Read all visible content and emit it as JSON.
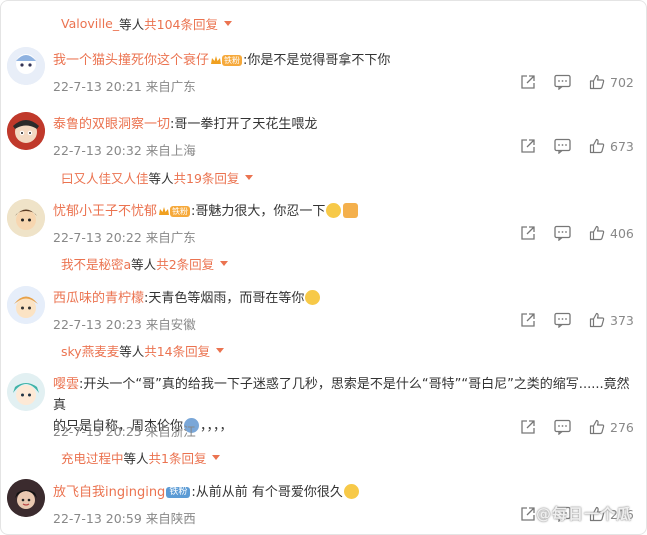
{
  "top_reply": {
    "user": "Valoville_",
    "middle": " 等人 ",
    "count": "共104条回复"
  },
  "comments": [
    {
      "user": "我一个猫头撞死你这个衰仔",
      "badge": "铁粉",
      "text": ":你是不是觉得哥拿不下你",
      "meta": "22-7-13 20:21 来自广东",
      "likes": "702"
    },
    {
      "user": "泰鲁的双眼洞察一切",
      "text": ":哥一拳打开了天花生喂龙",
      "meta": "22-7-13 20:32 来自上海",
      "likes": "673",
      "reply": {
        "user": "曰又人佳又人佳",
        "middle": " 等人 ",
        "count": "共19条回复"
      }
    },
    {
      "user": "忧郁小王子不忧郁",
      "badge": "铁粉",
      "text": ":哥魅力很大，你忍一下",
      "meta": "22-7-13 20:22 来自广东",
      "likes": "406",
      "reply": {
        "user": "我不是秘密a",
        "middle": " 等人 ",
        "count": "共2条回复"
      }
    },
    {
      "user": "西瓜味的青柠檬",
      "text": ":天青色等烟雨，而哥在等你",
      "meta": "22-7-13 20:23 来自安徽",
      "likes": "373",
      "reply": {
        "user": "sky燕麦麦",
        "middle": " 等人 ",
        "count": "共14条回复"
      }
    },
    {
      "user": "嘤雲",
      "text_line1": ":开头一个“哥”真的给我一下子迷惑了几秒，思索是不是什么“哥特”“哥白尼”之类的缩写......竟然真",
      "text_line2": "的只是自称，周杰伦你",
      "text_line2_tail": "，，，，",
      "meta": "22-7-13 20:25 来自浙江",
      "likes": "276",
      "reply": {
        "user": "充电过程中",
        "middle": " 等人 ",
        "count": "共1条回复"
      }
    },
    {
      "user": "放飞自我inginging",
      "badge": "铁粉",
      "text": ":从前从前 有个哥爱你很久",
      "meta": "22-7-13 20:59 来自陕西",
      "likes": "216"
    }
  ],
  "watermark": "@每日一个瓜",
  "colors": {
    "username": "#eb7350",
    "meta": "#888888",
    "badge": "#f6a93b",
    "badge_blue": "#5b9bd5"
  }
}
